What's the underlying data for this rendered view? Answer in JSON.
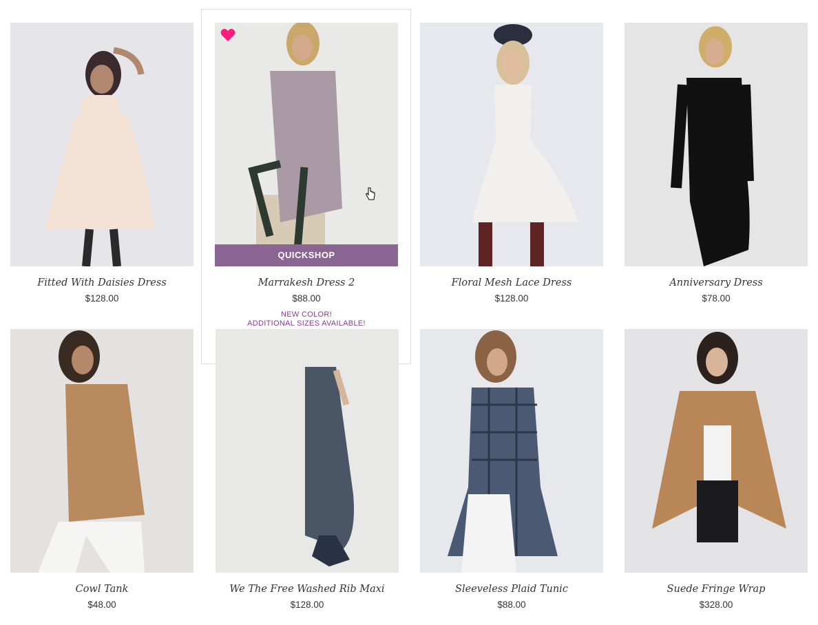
{
  "accent": "#8a6591",
  "heart_color": "#ff1c7c",
  "products": [
    {
      "name": "Fitted With Daisies Dress",
      "price": "$128.00"
    },
    {
      "name": "Marrakesh Dress 2",
      "price": "$88.00"
    },
    {
      "name": "Floral Mesh Lace Dress",
      "price": "$128.00"
    },
    {
      "name": "Anniversary Dress",
      "price": "$78.00"
    },
    {
      "name": "Cowl Tank",
      "price": "$48.00"
    },
    {
      "name": "We The Free Washed Rib Maxi",
      "price": "$128.00"
    },
    {
      "name": "Sleeveless Plaid Tunic",
      "price": "$88.00"
    },
    {
      "name": "Suede Fringe Wrap",
      "price": "$328.00"
    }
  ],
  "quickshop": {
    "label": "QUICKSHOP",
    "promo_line1": "NEW COLOR!",
    "promo_line2": "ADDITIONAL SIZES AVAILABLE!",
    "swatches": [
      {
        "name": "pink-print",
        "color": "#d79ab8",
        "selected": true
      },
      {
        "name": "brown-print",
        "color": "#7a6a52",
        "selected": false
      },
      {
        "name": "teal-print",
        "color": "#2f5b63",
        "selected": false
      },
      {
        "name": "dark-print",
        "color": "#263238",
        "selected": false
      },
      {
        "name": "rust-print",
        "color": "#8a6a4a",
        "selected": false
      }
    ]
  }
}
